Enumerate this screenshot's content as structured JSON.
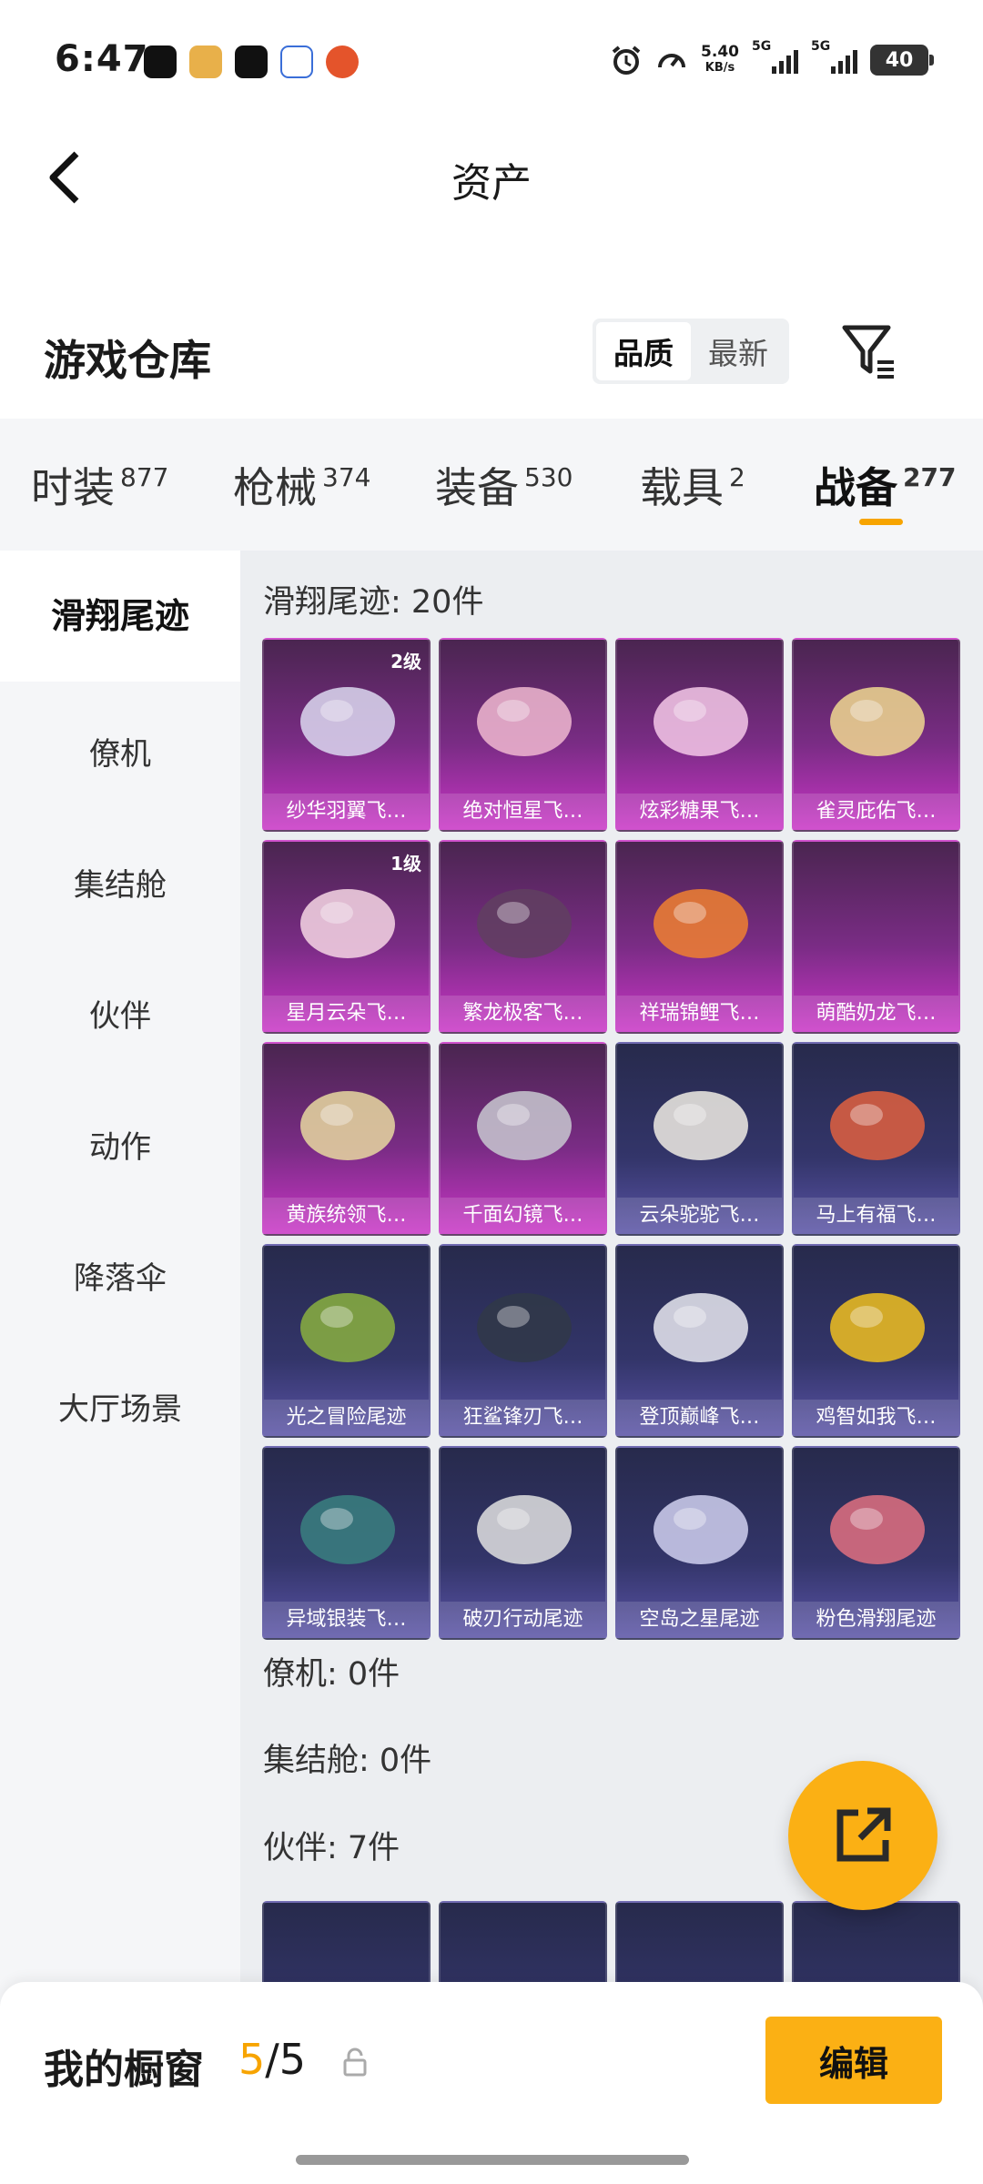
{
  "status_bar": {
    "time": "6:47",
    "net_speed_value": "5.40",
    "net_speed_unit": "KB/s",
    "signal1": "5G",
    "signal2": "5G",
    "battery": "40"
  },
  "header": {
    "title": "资产"
  },
  "section": {
    "title": "游戏仓库",
    "sort_options": [
      "品质",
      "最新"
    ],
    "active_sort": "品质"
  },
  "tabs": [
    {
      "label": "时装",
      "count": "877"
    },
    {
      "label": "枪械",
      "count": "374"
    },
    {
      "label": "装备",
      "count": "530"
    },
    {
      "label": "载具",
      "count": "2"
    },
    {
      "label": "战备",
      "count": "277",
      "active": true
    }
  ],
  "sidebar": {
    "items": [
      "滑翔尾迹",
      "僚机",
      "集结舱",
      "伙伴",
      "动作",
      "降落伞",
      "大厅场景"
    ],
    "active": "滑翔尾迹"
  },
  "groups": {
    "trail": {
      "title": "滑翔尾迹: 20件",
      "items": [
        {
          "name": "纱华羽翼飞…",
          "level": "2级",
          "tier": "pink"
        },
        {
          "name": "绝对恒星飞…",
          "tier": "pink"
        },
        {
          "name": "炫彩糖果飞…",
          "tier": "pink"
        },
        {
          "name": "雀灵庇佑飞…",
          "tier": "pink"
        },
        {
          "name": "星月云朵飞…",
          "level": "1级",
          "tier": "pink"
        },
        {
          "name": "繁龙极客飞…",
          "tier": "pink"
        },
        {
          "name": "祥瑞锦鲤飞…",
          "tier": "pink"
        },
        {
          "name": "萌酷奶龙飞…",
          "tier": "pink"
        },
        {
          "name": "黄族统领飞…",
          "tier": "pink"
        },
        {
          "name": "千面幻镜飞…",
          "tier": "pink"
        },
        {
          "name": "云朵驼驼飞…",
          "tier": "purple"
        },
        {
          "name": "马上有福飞…",
          "tier": "purple"
        },
        {
          "name": "光之冒险尾迹",
          "tier": "purple"
        },
        {
          "name": "狂鲨锋刃飞…",
          "tier": "purple"
        },
        {
          "name": "登顶巅峰飞…",
          "tier": "purple"
        },
        {
          "name": "鸡智如我飞…",
          "tier": "purple"
        },
        {
          "name": "异域银装飞…",
          "tier": "purple"
        },
        {
          "name": "破刃行动尾迹",
          "tier": "purple"
        },
        {
          "name": "空岛之星尾迹",
          "tier": "purple"
        },
        {
          "name": "粉色滑翔尾迹",
          "tier": "purple"
        }
      ]
    },
    "wingman": {
      "title": "僚机: 0件"
    },
    "capsule": {
      "title": "集结舱: 0件"
    },
    "partner": {
      "title": "伙伴: 7件"
    }
  },
  "bottom_bar": {
    "label": "我的橱窗",
    "count_current": "5",
    "count_sep": "/",
    "count_total": "5",
    "edit_label": "编辑"
  },
  "colors": {
    "accent": "#fbb014",
    "pink_tier": "#c935c6",
    "purple_tier": "#5a53a6"
  }
}
